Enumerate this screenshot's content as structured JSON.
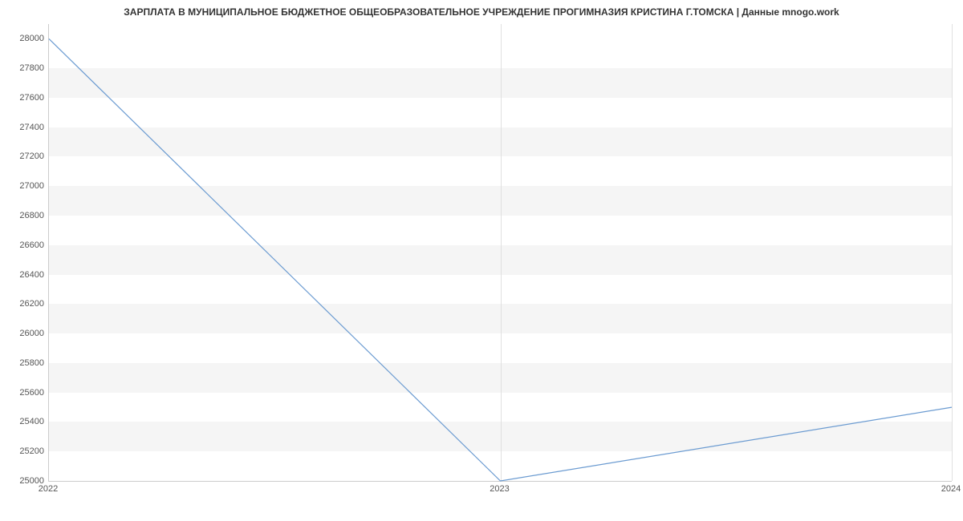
{
  "chart_data": {
    "type": "line",
    "title": "ЗАРПЛАТА В МУНИЦИПАЛЬНОЕ БЮДЖЕТНОЕ ОБЩЕОБРАЗОВАТЕЛЬНОЕ УЧРЕЖДЕНИЕ ПРОГИМНАЗИЯ КРИСТИНА Г.ТОМСКА | Данные mnogo.work",
    "xlabel": "",
    "ylabel": "",
    "x_ticks": [
      "2022",
      "2023",
      "2024"
    ],
    "y_ticks": [
      25000,
      25200,
      25400,
      25600,
      25800,
      26000,
      26200,
      26400,
      26600,
      26800,
      27000,
      27200,
      27400,
      27600,
      27800,
      28000
    ],
    "ylim": [
      25000,
      28100
    ],
    "x": [
      "2022",
      "2023",
      "2024"
    ],
    "values": [
      28000,
      25000,
      25500
    ],
    "series_color": "#6b9bd1"
  }
}
